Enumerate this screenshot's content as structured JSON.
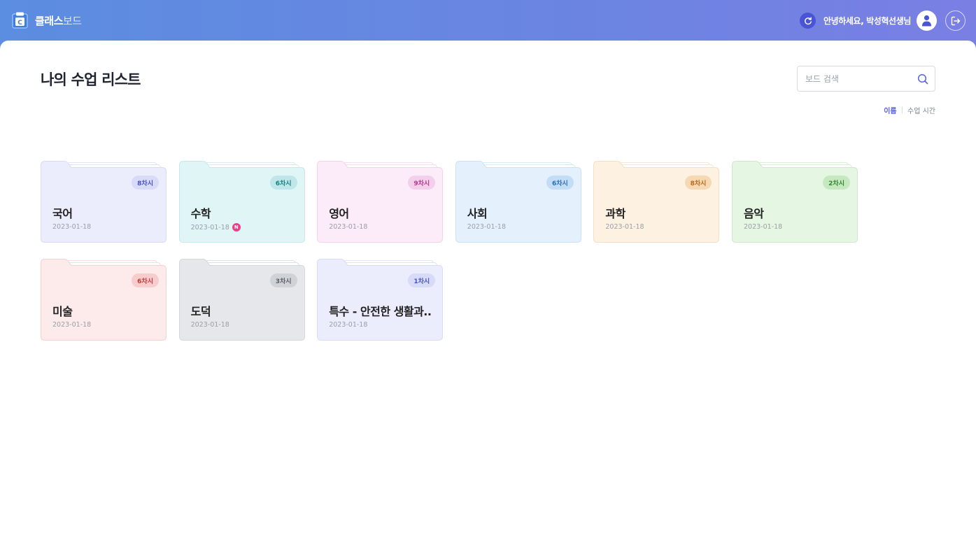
{
  "header": {
    "brand_main": "클래스",
    "brand_sub": "보드",
    "greeting": "안녕하세요, 박성혁선생님"
  },
  "main": {
    "title": "나의 수업 리스트",
    "search_placeholder": "보드 검색",
    "sort": {
      "active": "이름",
      "separator": "|",
      "other": "수업 시간"
    }
  },
  "boards": [
    {
      "title": "국어",
      "date": "2023-01-18",
      "badge": "8차시",
      "color": "#ebedfd",
      "border": "#d8dcf6",
      "tab": "#e3e6fb",
      "badge_bg": "#d7dbf7",
      "badge_fg": "#4a52c8",
      "is_new": false
    },
    {
      "title": "수학",
      "date": "2023-01-18",
      "badge": "6차시",
      "color": "#e0f5f6",
      "border": "#c6e9ec",
      "tab": "#d5f0f2",
      "badge_bg": "#bfe6e8",
      "badge_fg": "#187f86",
      "is_new": true,
      "new_label": "N"
    },
    {
      "title": "영어",
      "date": "2023-01-18",
      "badge": "9차시",
      "color": "#fcebf8",
      "border": "#f2d3ed",
      "tab": "#f8e2f4",
      "badge_bg": "#f3cfeb",
      "badge_fg": "#b3398f",
      "is_new": false
    },
    {
      "title": "사회",
      "date": "2023-01-18",
      "badge": "6차시",
      "color": "#e4f1fd",
      "border": "#cbe2f8",
      "tab": "#dbebfb",
      "badge_bg": "#c4ddf6",
      "badge_fg": "#2a6fb8",
      "is_new": false
    },
    {
      "title": "과학",
      "date": "2023-01-18",
      "badge": "8차시",
      "color": "#fdf1e2",
      "border": "#f4dfc4",
      "tab": "#fae9d4",
      "badge_bg": "#f6d9b3",
      "badge_fg": "#b8691c",
      "is_new": false
    },
    {
      "title": "음악",
      "date": "2023-01-18",
      "badge": "2차시",
      "color": "#e5f6e3",
      "border": "#cce9c8",
      "tab": "#dcf1d9",
      "badge_bg": "#c6e8c1",
      "badge_fg": "#2f8a2a",
      "is_new": false
    },
    {
      "title": "미술",
      "date": "2023-01-18",
      "badge": "6차시",
      "color": "#fdeaea",
      "border": "#f5d2d2",
      "tab": "#fbe0e0",
      "badge_bg": "#f7cccc",
      "badge_fg": "#c23b3b",
      "is_new": false
    },
    {
      "title": "도덕",
      "date": "2023-01-18",
      "badge": "3차시",
      "color": "#e5e7ea",
      "border": "#d4d7dc",
      "tab": "#dcdfe3",
      "badge_bg": "#cfd2d7",
      "badge_fg": "#5a5f68",
      "is_new": false
    },
    {
      "title": "특수 - 안전한 생활과..",
      "date": "2023-01-18",
      "badge": "1차시",
      "color": "#ebedfd",
      "border": "#d8dcf6",
      "tab": "#e3e6fb",
      "badge_bg": "#d7dbf7",
      "badge_fg": "#4a52c8",
      "is_new": false
    }
  ]
}
